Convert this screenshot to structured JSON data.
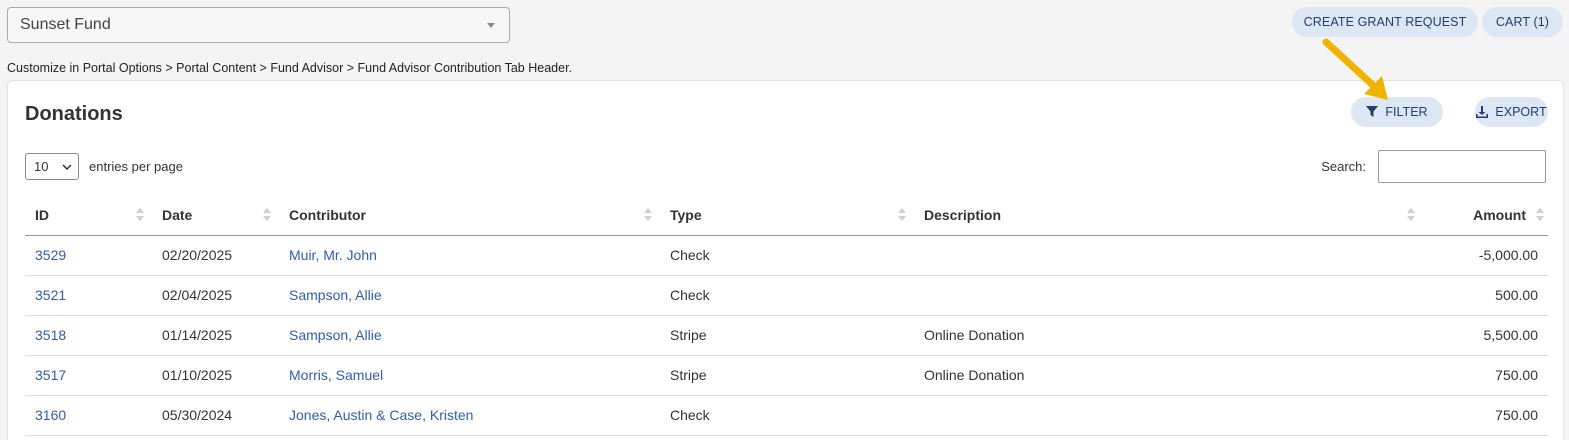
{
  "fund_selector": {
    "value": "Sunset Fund"
  },
  "top_buttons": {
    "grant": "CREATE GRANT REQUEST",
    "cart": "CART (1)"
  },
  "breadcrumb": "Customize in Portal Options > Portal Content > Fund Advisor > Fund Advisor Contribution Tab Header.",
  "card": {
    "title": "Donations",
    "filter_label": "FILTER",
    "export_label": "EXPORT",
    "entries_value": "10",
    "entries_label": "entries per page",
    "search_label": "Search:",
    "search_value": ""
  },
  "table": {
    "headers": [
      "ID",
      "Date",
      "Contributor",
      "Type",
      "Description",
      "Amount"
    ],
    "rows": [
      {
        "id": "3529",
        "date": "02/20/2025",
        "contributor": "Muir, Mr. John",
        "type": "Check",
        "description": "",
        "amount": "-5,000.00"
      },
      {
        "id": "3521",
        "date": "02/04/2025",
        "contributor": "Sampson, Allie",
        "type": "Check",
        "description": "",
        "amount": "500.00"
      },
      {
        "id": "3518",
        "date": "01/14/2025",
        "contributor": "Sampson, Allie",
        "type": "Stripe",
        "description": "Online Donation",
        "amount": "5,500.00"
      },
      {
        "id": "3517",
        "date": "01/10/2025",
        "contributor": "Morris, Samuel",
        "type": "Stripe",
        "description": "Online Donation",
        "amount": "750.00"
      },
      {
        "id": "3160",
        "date": "05/30/2024",
        "contributor": "Jones, Austin & Case, Kristen",
        "type": "Check",
        "description": "",
        "amount": "750.00"
      }
    ]
  },
  "colors": {
    "link": "#2f5fa7",
    "pill_bg": "#dde7f3",
    "arrow": "#f0b400"
  }
}
